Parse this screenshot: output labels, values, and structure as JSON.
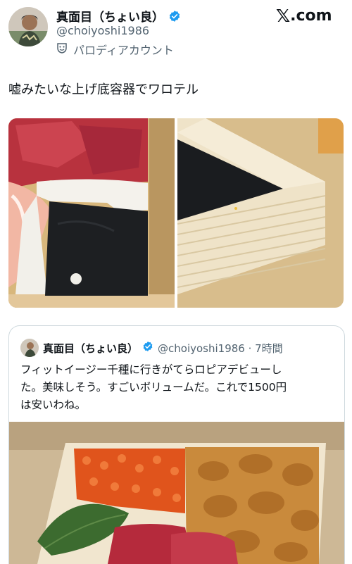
{
  "tweet": {
    "display_name": "真面目（ちょい良）",
    "handle": "@choiyoshi1986",
    "parody_label": "パロディアカウント",
    "text": "嘘みたいな上げ底容器でワロテル"
  },
  "branding": {
    "x_logo": "𝕏",
    "site": ".com"
  },
  "quote": {
    "display_name": "真面目（ちょい良）",
    "handle_time": "@choiyoshi1986 · 7時間",
    "text_lines": [
      "フィットイージー千種に行きがてらロピアデビューし",
      "た。美味しそう。すごいボリュームだ。これで1500円",
      "は安いわね。"
    ]
  },
  "colors": {
    "verified": "#1d9bf0",
    "secondary_text": "#536471",
    "border": "#cfd9de"
  },
  "icons": [
    "verified-badge-icon",
    "parody-mask-icon",
    "x-logo"
  ]
}
